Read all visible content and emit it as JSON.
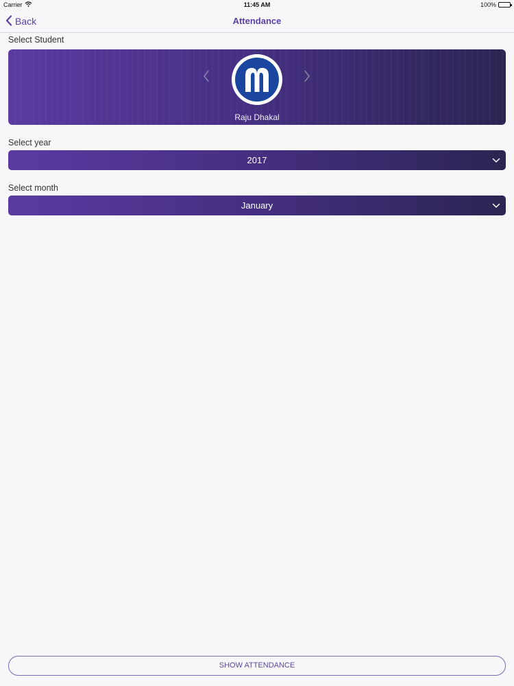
{
  "status_bar": {
    "carrier": "Carrier",
    "time": "11:45 AM",
    "battery": "100%",
    "icons": [
      "wifi-icon",
      "battery-icon"
    ]
  },
  "nav": {
    "back_label": "Back",
    "title": "Attendance",
    "back_icon": "chevron-left-icon"
  },
  "student": {
    "label": "Select Student",
    "name": "Raju Dhakal",
    "prev_icon": "chevron-left-icon",
    "next_icon": "chevron-right-icon",
    "avatar_icon": "school-logo-icon"
  },
  "year": {
    "label": "Select year",
    "value": "2017",
    "icon": "chevron-down-icon"
  },
  "month": {
    "label": "Select month",
    "value": "January",
    "icon": "chevron-down-icon"
  },
  "actions": {
    "show_attendance": "SHOW ATTENDANCE"
  },
  "colors": {
    "accent": "#5b3fa6",
    "gradient_start": "#5a3aa0",
    "gradient_end": "#2c2452",
    "logo_blue": "#1a46a0",
    "background": "#f7f6f9"
  }
}
